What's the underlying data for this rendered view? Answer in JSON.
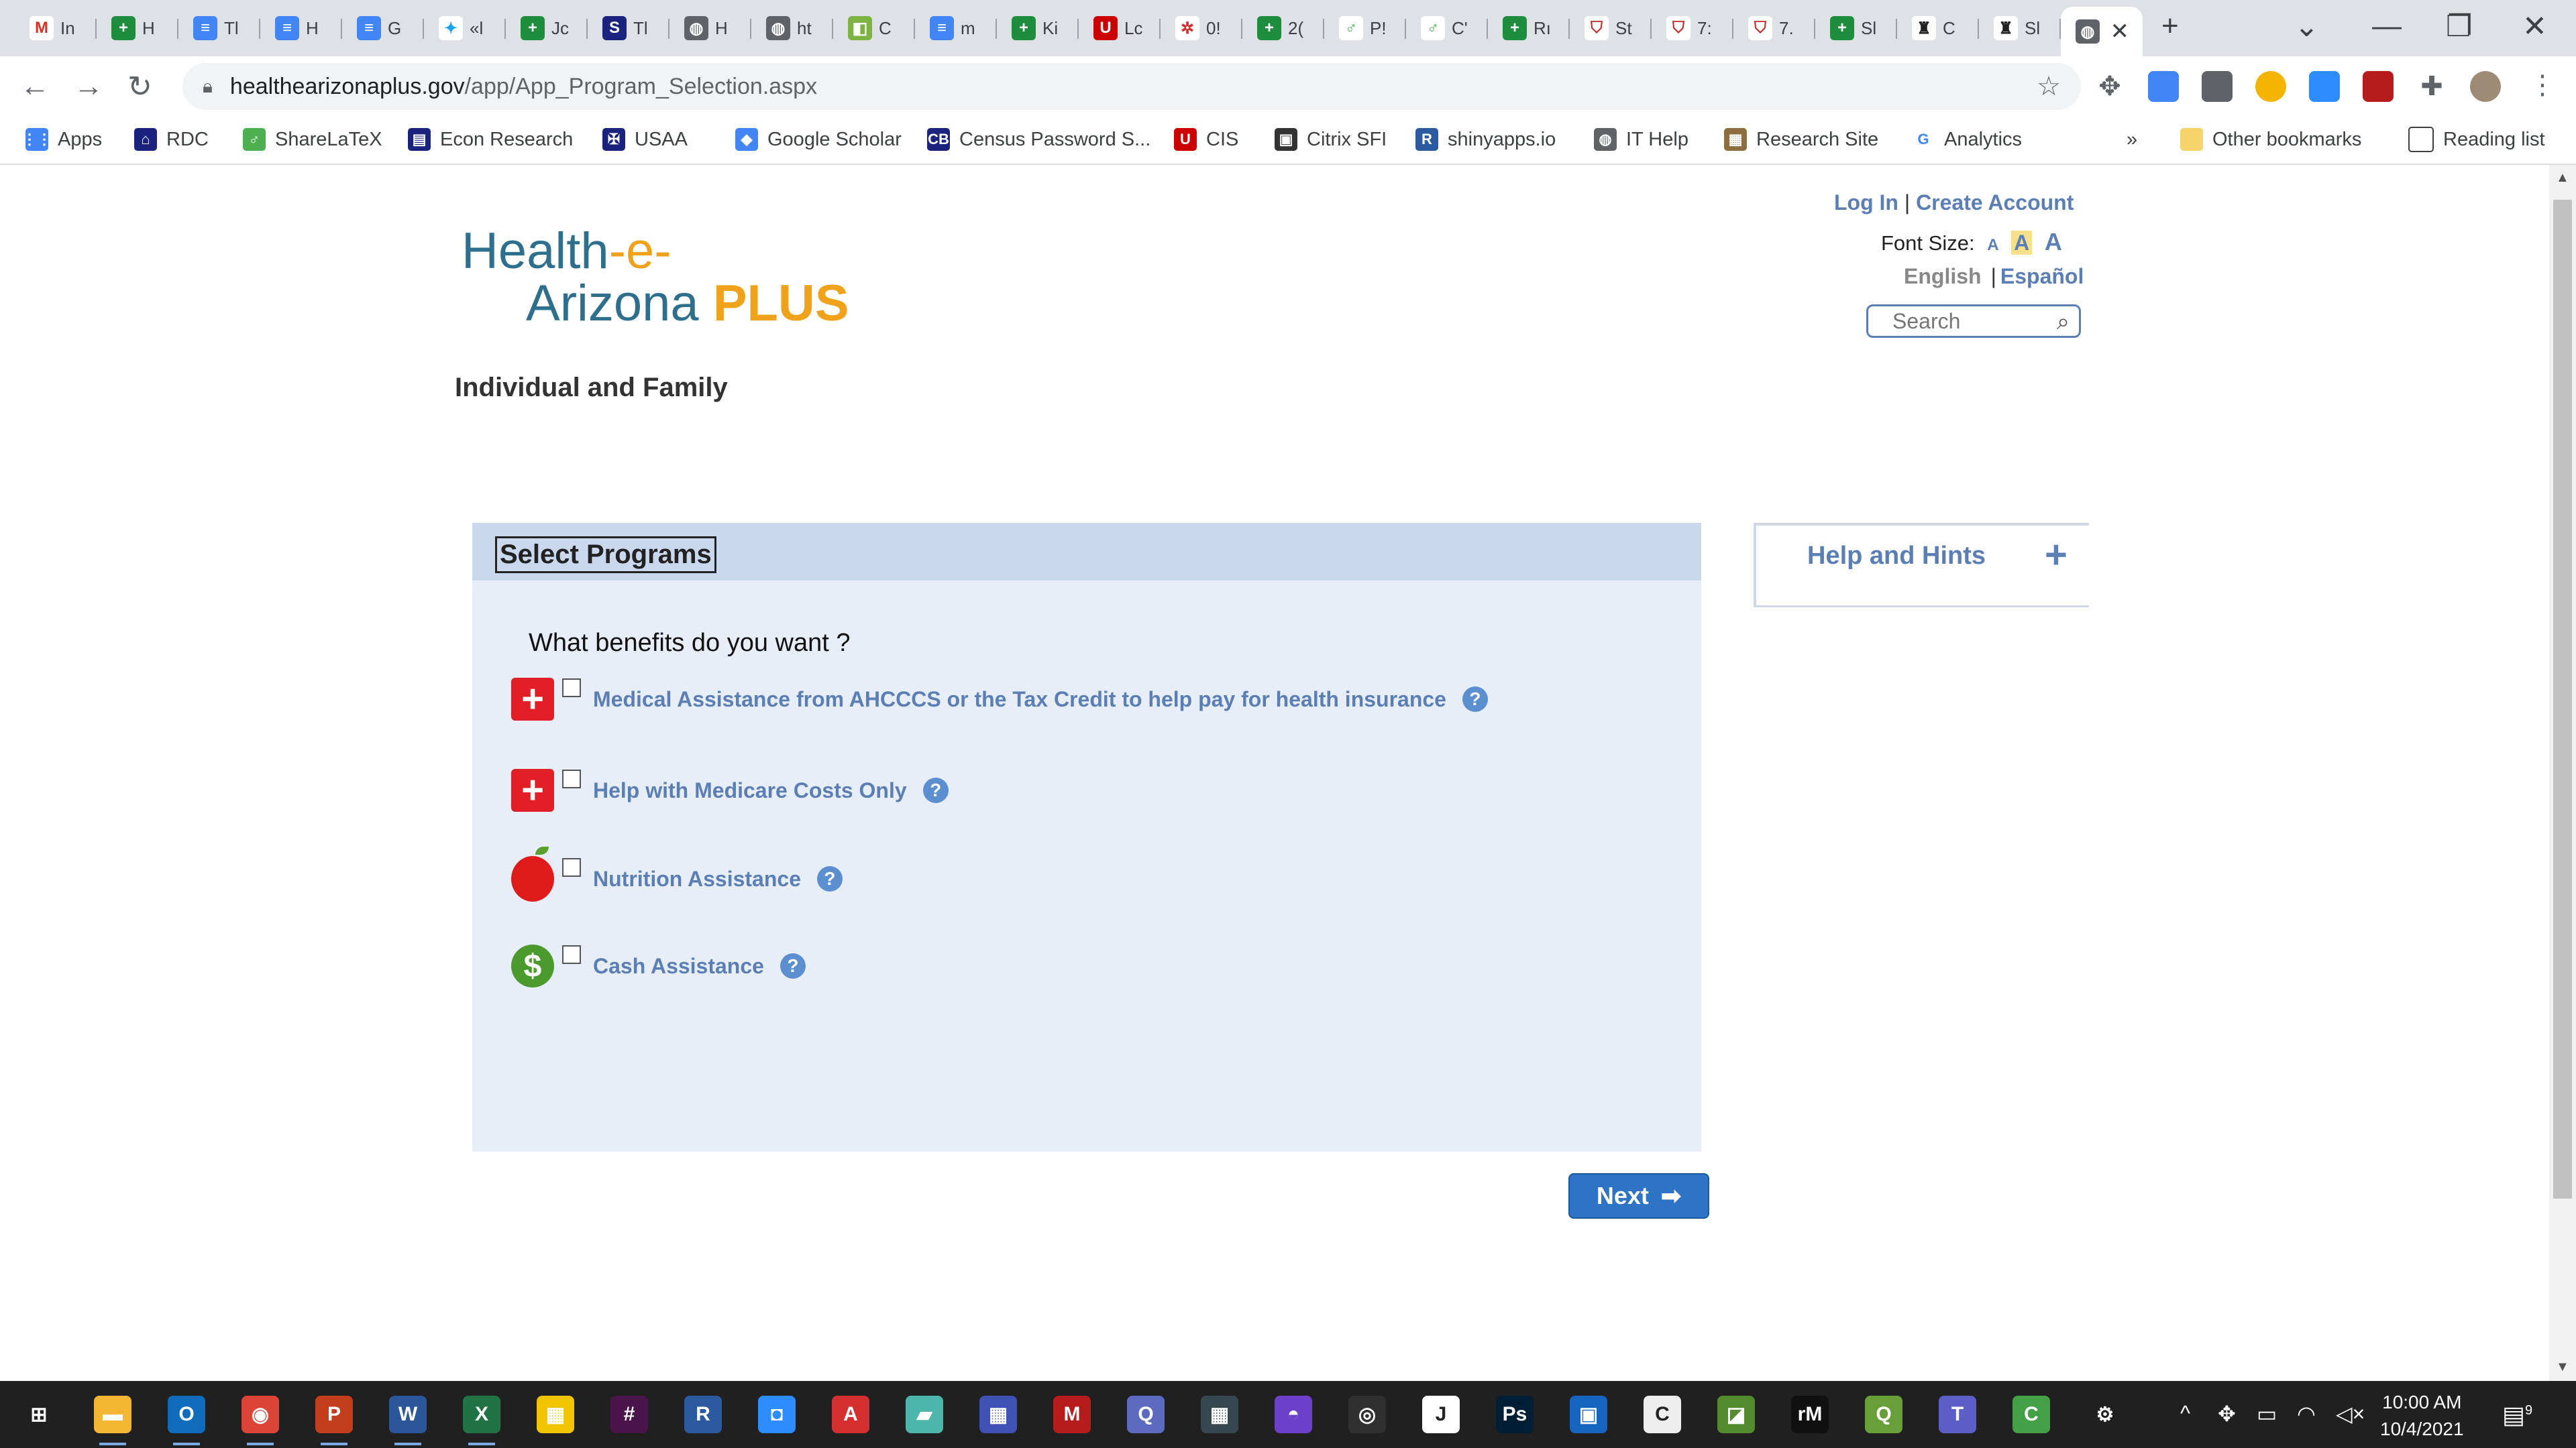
{
  "browser": {
    "tabs": [
      {
        "short": "In",
        "icon": "gmail-icon",
        "color": "#ffffff",
        "glyph": "M",
        "glyph_color": "#d93025"
      },
      {
        "short": "H",
        "icon": "sheets-icon",
        "color": "#1e8e3e",
        "glyph": "+"
      },
      {
        "short": "Tl",
        "icon": "docs-icon",
        "color": "#4285f4",
        "glyph": "≡"
      },
      {
        "short": "H",
        "icon": "docs-icon",
        "color": "#4285f4",
        "glyph": "≡"
      },
      {
        "short": "G",
        "icon": "docs-icon",
        "color": "#4285f4",
        "glyph": "≡"
      },
      {
        "short": "«l",
        "icon": "twitter-icon",
        "color": "#ffffff",
        "glyph": "✦",
        "glyph_color": "#1da1f2"
      },
      {
        "short": "Jc",
        "icon": "sheets-icon",
        "color": "#1e8e3e",
        "glyph": "+"
      },
      {
        "short": "Tl",
        "icon": "s-circle-icon",
        "color": "#1a237e",
        "glyph": "S"
      },
      {
        "short": "H",
        "icon": "globe-icon",
        "color": "#5f6368",
        "glyph": "◍"
      },
      {
        "short": "ht",
        "icon": "globe-icon",
        "color": "#5f6368",
        "glyph": "◍"
      },
      {
        "short": "C",
        "icon": "calendar-icon",
        "color": "#7cb342",
        "glyph": "◧"
      },
      {
        "short": "m",
        "icon": "docs-icon",
        "color": "#4285f4",
        "glyph": "≡"
      },
      {
        "short": "Ki",
        "icon": "sheets-icon",
        "color": "#1e8e3e",
        "glyph": "+"
      },
      {
        "short": "Lc",
        "icon": "utah-icon",
        "color": "#cc0000",
        "glyph": "U"
      },
      {
        "short": "0!",
        "icon": "gear-red-icon",
        "color": "#ffffff",
        "glyph": "✲",
        "glyph_color": "#d32f2f"
      },
      {
        "short": "2(",
        "icon": "sheets-icon",
        "color": "#1e8e3e",
        "glyph": "+"
      },
      {
        "short": "P!",
        "icon": "overleaf-icon",
        "color": "#ffffff",
        "glyph": "♂",
        "glyph_color": "#4caf50"
      },
      {
        "short": "C'",
        "icon": "overleaf-icon",
        "color": "#ffffff",
        "glyph": "♂",
        "glyph_color": "#4caf50"
      },
      {
        "short": "Rı",
        "icon": "sheets-icon",
        "color": "#1e8e3e",
        "glyph": "+"
      },
      {
        "short": "St",
        "icon": "shield-icon",
        "color": "#ffffff",
        "glyph": "⛉",
        "glyph_color": "#c62828"
      },
      {
        "short": "7:",
        "icon": "shield-icon",
        "color": "#ffffff",
        "glyph": "⛉",
        "glyph_color": "#c62828"
      },
      {
        "short": "7.",
        "icon": "shield-icon",
        "color": "#ffffff",
        "glyph": "⛉",
        "glyph_color": "#c62828"
      },
      {
        "short": "Sl",
        "icon": "sheets-icon",
        "color": "#1e8e3e",
        "glyph": "+"
      },
      {
        "short": "C",
        "icon": "census-icon",
        "color": "#ffffff",
        "glyph": "♜",
        "glyph_color": "#222"
      },
      {
        "short": "Sl",
        "icon": "census-icon",
        "color": "#ffffff",
        "glyph": "♜",
        "glyph_color": "#222"
      }
    ],
    "active_tab_close": "✕",
    "new_tab": "+",
    "url_host": "healthearizonaplus.gov",
    "url_path": "/app/App_Program_Selection.aspx",
    "bookmarks": [
      {
        "label": "Apps",
        "icon": "apps-grid-icon",
        "color": "#4285f4",
        "glyph": "⋮⋮"
      },
      {
        "label": "RDC",
        "icon": "rdc-icon",
        "color": "#1a237e",
        "glyph": "⌂"
      },
      {
        "label": "ShareLaTeX",
        "icon": "sharelatex-icon",
        "color": "#4caf50",
        "glyph": "♂"
      },
      {
        "label": "Econ Research",
        "icon": "econ-icon",
        "color": "#1a237e",
        "glyph": "▤"
      },
      {
        "label": "USAA",
        "icon": "usaa-icon",
        "color": "#1a237e",
        "glyph": "✠"
      },
      {
        "label": "Google Scholar",
        "icon": "scholar-icon",
        "color": "#4285f4",
        "glyph": "◆"
      },
      {
        "label": "Census Password S...",
        "icon": "census-bureau-icon",
        "color": "#1a237e",
        "glyph": "CB"
      },
      {
        "label": "CIS",
        "icon": "utah-icon",
        "color": "#cc0000",
        "glyph": "U"
      },
      {
        "label": "Citrix SFI",
        "icon": "citrix-icon",
        "color": "#333333",
        "glyph": "▣"
      },
      {
        "label": "shinyapps.io",
        "icon": "r-icon",
        "color": "#2c5aa0",
        "glyph": "R"
      },
      {
        "label": "IT Help",
        "icon": "globe-icon",
        "color": "#5f6368",
        "glyph": "◍"
      },
      {
        "label": "Research Site",
        "icon": "research-site-icon",
        "color": "#8d6e3f",
        "glyph": "▦"
      },
      {
        "label": "Analytics",
        "icon": "google-icon",
        "color": "#ffffff",
        "glyph": "G"
      }
    ],
    "bookmarks_overflow": "»",
    "other_bookmarks": "Other bookmarks",
    "reading_list": "Reading list"
  },
  "page": {
    "logo_line1": "Health",
    "logo_dash1": "-e-",
    "logo_line2": "Arizona",
    "logo_plus": "PLUS",
    "header_title": "Individual and Family",
    "login": "Log In",
    "create_account": "Create Account",
    "font_size_label": "Font Size:",
    "font_sizes": [
      "A",
      "A",
      "A"
    ],
    "lang_english": "English",
    "lang_spanish": "Español",
    "search_placeholder": "Search",
    "panel_title": "Select Programs",
    "question": "What benefits do you want ?",
    "programs": [
      {
        "label": "Medical Assistance from AHCCCS or the Tax Credit to help pay for health insurance",
        "checked": false
      },
      {
        "label": "Help with Medicare Costs Only",
        "checked": false
      },
      {
        "label": "Nutrition Assistance",
        "checked": false
      },
      {
        "label": "Cash Assistance",
        "checked": false
      }
    ],
    "help_glyph": "?",
    "next_label": "Next",
    "help_hints_title": "Help and Hints",
    "help_hints_toggle": "+"
  },
  "taskbar": {
    "apps": [
      {
        "icon": "windows-start-icon",
        "color": "#202020",
        "glyph": "⊞"
      },
      {
        "icon": "file-explorer-icon",
        "color": "#f2b632",
        "glyph": "▬"
      },
      {
        "icon": "outlook-icon",
        "color": "#0f6cbd",
        "glyph": "O"
      },
      {
        "icon": "chrome-icon",
        "color": "#db4437",
        "glyph": "◉"
      },
      {
        "icon": "powerpoint-icon",
        "color": "#c43e1c",
        "glyph": "P"
      },
      {
        "icon": "word-icon",
        "color": "#2b579a",
        "glyph": "W"
      },
      {
        "icon": "excel-icon",
        "color": "#217346",
        "glyph": "X"
      },
      {
        "icon": "pdf-tool-icon",
        "color": "#f0c400",
        "glyph": "▦"
      },
      {
        "icon": "slack-icon",
        "color": "#4a154b",
        "glyph": "#"
      },
      {
        "icon": "r-icon",
        "color": "#2c5aa0",
        "glyph": "R"
      },
      {
        "icon": "zoom-icon",
        "color": "#2d8cff",
        "glyph": "◘"
      },
      {
        "icon": "acrobat-icon",
        "color": "#d32f2f",
        "glyph": "A"
      },
      {
        "icon": "notepad-icon",
        "color": "#4db6ac",
        "glyph": "▰"
      },
      {
        "icon": "calendar-app-icon",
        "color": "#3f51b5",
        "glyph": "▦"
      },
      {
        "icon": "mendeley-icon",
        "color": "#b71c1c",
        "glyph": "M"
      },
      {
        "icon": "onenote-q-icon",
        "color": "#5c6bc0",
        "glyph": "Q"
      },
      {
        "icon": "calculator-icon",
        "color": "#37474f",
        "glyph": "▦"
      },
      {
        "icon": "github-icon",
        "color": "#6e40c9",
        "glyph": "◓"
      },
      {
        "icon": "obs-icon",
        "color": "#303030",
        "glyph": "◎"
      },
      {
        "icon": "jupyter-icon",
        "color": "#ffffff",
        "glyph": "J"
      },
      {
        "icon": "photoshop-icon",
        "color": "#001e36",
        "glyph": "Ps"
      },
      {
        "icon": "virtualbox-icon",
        "color": "#1565c0",
        "glyph": "▣"
      },
      {
        "icon": "citrix-app-icon",
        "color": "#eeeeee",
        "glyph": "C"
      },
      {
        "icon": "maps-app-icon",
        "color": "#558b2f",
        "glyph": "◪"
      },
      {
        "icon": "rm-icon",
        "color": "#111111",
        "glyph": "rM"
      },
      {
        "icon": "qgis-icon",
        "color": "#689f38",
        "glyph": "Q"
      },
      {
        "icon": "teams-icon",
        "color": "#5b5fc7",
        "glyph": "T"
      },
      {
        "icon": "camtasia-icon",
        "color": "#43a047",
        "glyph": "C"
      },
      {
        "icon": "settings-icon",
        "color": "#202020",
        "glyph": "⚙"
      }
    ],
    "time": "10:00 AM",
    "date": "10/4/2021",
    "notifications": "9"
  }
}
